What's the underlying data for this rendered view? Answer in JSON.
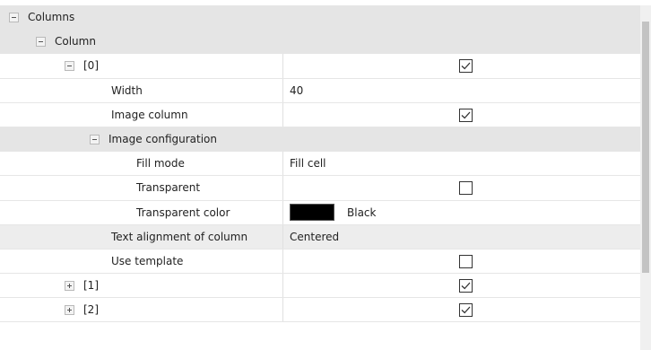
{
  "rows": [
    {
      "label": "Columns",
      "type": "category",
      "expander": "minus"
    },
    {
      "label": "Column",
      "type": "category",
      "expander": "minus"
    },
    {
      "label": "[0]",
      "type": "check",
      "expander": "minus",
      "checked": true
    },
    {
      "label": "Width",
      "type": "text",
      "value": "40"
    },
    {
      "label": "Image column",
      "type": "check",
      "checked": true
    },
    {
      "label": "Image configuration",
      "type": "category",
      "expander": "minus"
    },
    {
      "label": "Fill mode",
      "type": "text",
      "value": "Fill cell"
    },
    {
      "label": "Transparent",
      "type": "check",
      "checked": false
    },
    {
      "label": "Transparent color",
      "type": "color",
      "value": "Black",
      "color": "#000000"
    },
    {
      "label": "Text alignment of column",
      "type": "text",
      "value": "Centered",
      "selected": true
    },
    {
      "label": "Use template",
      "type": "check",
      "checked": false
    },
    {
      "label": "[1]",
      "type": "check",
      "expander": "plus",
      "checked": true
    },
    {
      "label": "[2]",
      "type": "check",
      "expander": "plus",
      "checked": true
    }
  ]
}
